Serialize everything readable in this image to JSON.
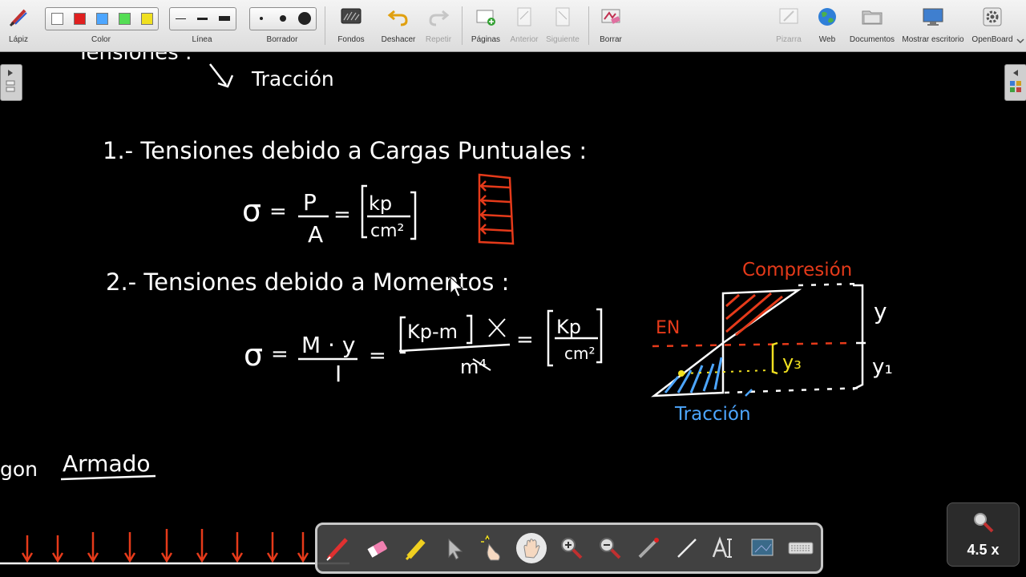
{
  "toolbar": {
    "left": {
      "pen": "Lápiz",
      "color": "Color",
      "line": "Línea",
      "eraser": "Borrador",
      "backgrounds": "Fondos",
      "undo": "Deshacer",
      "redo": "Repetir",
      "pages": "Páginas",
      "previous": "Anterior",
      "next": "Siguiente",
      "clear": "Borrar"
    },
    "right": {
      "board": "Pizarra",
      "web": "Web",
      "documents": "Documentos",
      "desktop": "Mostrar escritorio",
      "app": "OpenBoard"
    },
    "colors": [
      "#ffffff",
      "#e02020",
      "#4da6ff",
      "#55dd55",
      "#f0e020"
    ]
  },
  "board": {
    "top_partial": "Tensiones :",
    "traction_top": "Tracción",
    "heading1": "1.- Tensiones debido a Cargas Puntuales :",
    "formula1": {
      "sigma": "σ",
      "eq": "=",
      "numerator": "P",
      "denominator": "A",
      "unit_num": "kp",
      "unit_den": "cm²"
    },
    "heading2": "2.- Tensiones debido a Momentos :",
    "formula2": {
      "sigma": "σ",
      "eq": "=",
      "numerator": "M · y",
      "denominator": "I",
      "unit_num": "Kp-m",
      "unit_den": "m⁴",
      "unit_num2": "Kp",
      "unit_den2": "cm²"
    },
    "diagram": {
      "compression": "Compresión",
      "en": "EN",
      "traction": "Tracción",
      "y": "y",
      "y1": "y₁",
      "y3": "y₃"
    },
    "armado": "Armado",
    "armado_prefix": "gon"
  },
  "zoom": "4.5 x"
}
